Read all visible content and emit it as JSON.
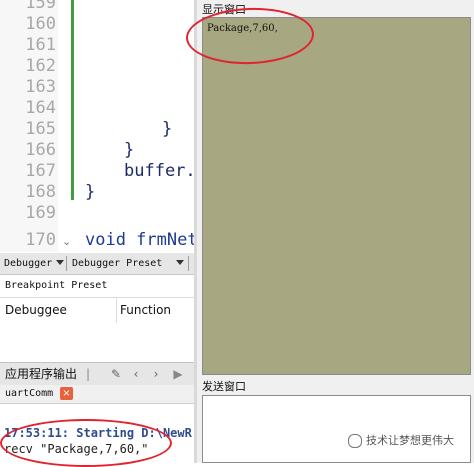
{
  "editor": {
    "line_numbers": [
      "159",
      "160",
      "161",
      "162",
      "163",
      "164",
      "165",
      "166",
      "167",
      "168",
      "169",
      "170"
    ],
    "code_lines": [
      {
        "ln": "165",
        "text": "}"
      },
      {
        "ln": "166",
        "text": "}"
      },
      {
        "ln": "167",
        "text": "buffer."
      },
      {
        "ln": "168",
        "text": "}"
      },
      {
        "ln": "170",
        "text": "void frmNet"
      }
    ]
  },
  "debugger": {
    "header_left": "Debugger",
    "header_right": "Debugger Preset",
    "breakpoint_preset": "Breakpoint Preset",
    "col_debuggee": "Debuggee",
    "col_function": "Function"
  },
  "output": {
    "title": "应用程序输出",
    "tab_label": "uartComm",
    "tab_close": "×",
    "line1": "17:53:11: Starting D:\\NewR",
    "line2": "recv \"Package,7,60,\""
  },
  "serial": {
    "recv_label": "显示窗口",
    "recv_text": "Package,7,60,",
    "send_label": "发送窗口",
    "watermark": "技术让梦想更伟大"
  },
  "colors": {
    "recv_bg": "#a7a781",
    "annotation": "#e0232e"
  }
}
